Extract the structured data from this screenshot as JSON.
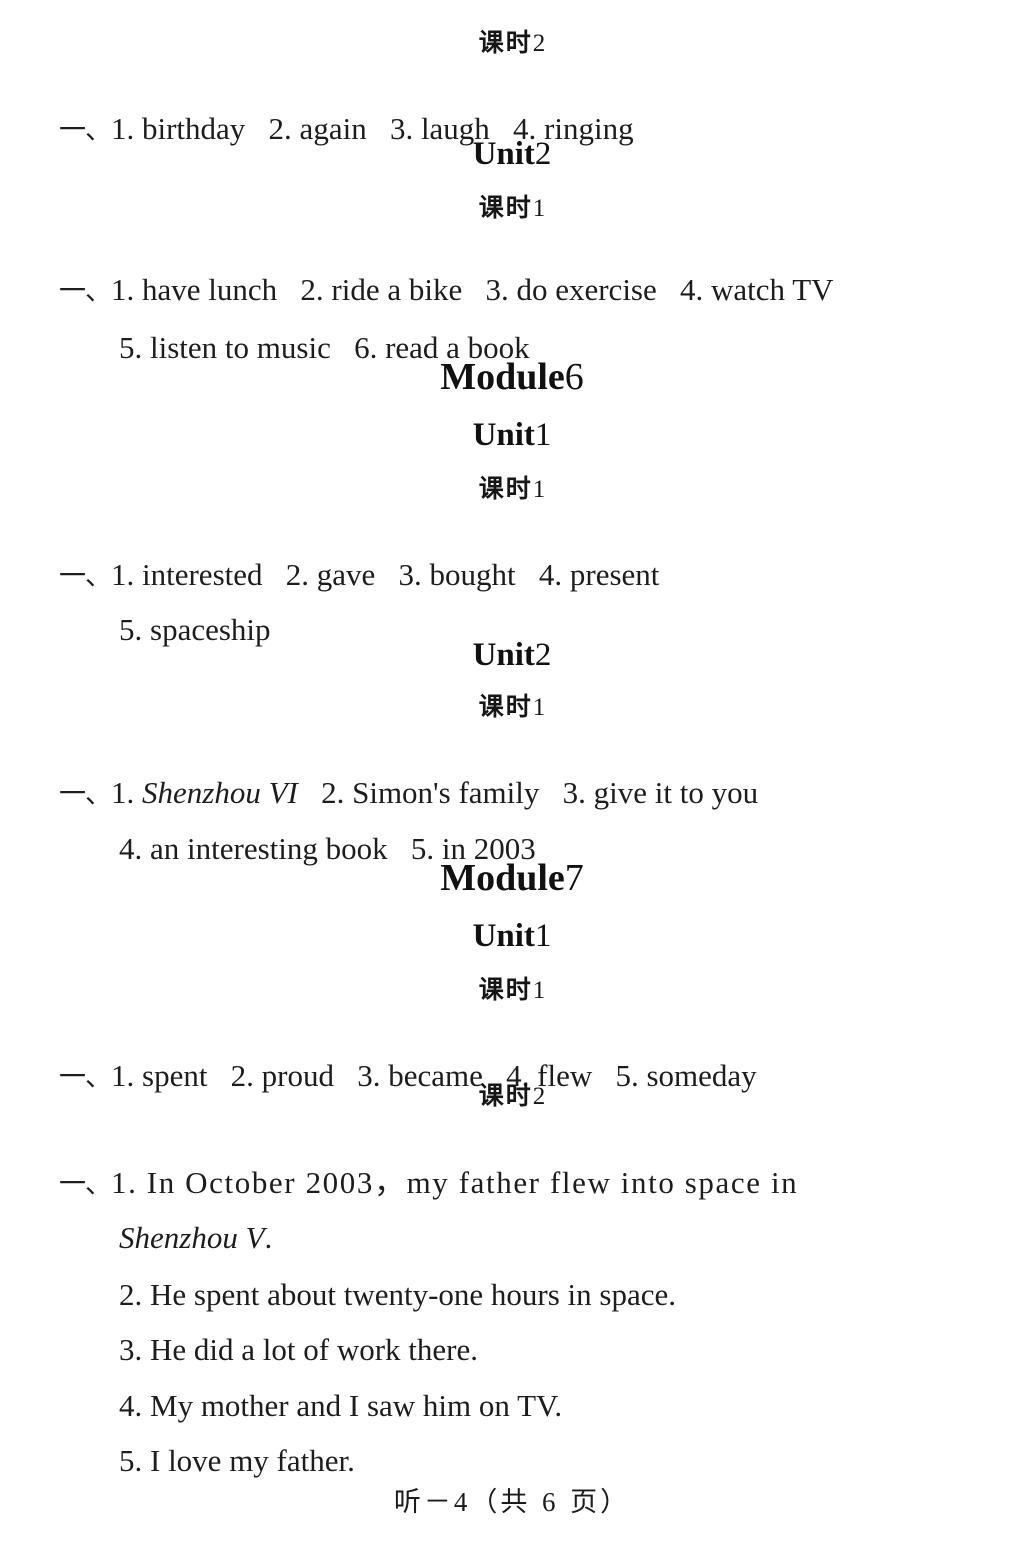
{
  "document": {
    "background_color": "#ffffff",
    "text_color": "#1b1b1b"
  },
  "labels": {
    "keshi": "课时",
    "unit": "Unit",
    "module": "Module",
    "section_marker": "一、"
  },
  "blocks": {
    "m5u1_keshi2": {
      "label": "课时",
      "num": "2"
    },
    "m5u1_keshi2_answers": "1. birthday   2. again   3. laugh   4. ringing",
    "m5u2_heading": {
      "label": "Unit",
      "num": "2"
    },
    "m5u2_keshi1": {
      "label": "课时",
      "num": "1"
    },
    "m5u2_line1": "1. have lunch   2. ride a bike   3. do exercise   4. watch TV",
    "m5u2_line2": "5. listen to music   6. read a book",
    "module6_heading": {
      "label": "Module",
      "num": "6"
    },
    "m6u1_heading": {
      "label": "Unit",
      "num": "1"
    },
    "m6u1_keshi1": {
      "label": "课时",
      "num": "1"
    },
    "m6u1_line1": "1. interested   2. gave   3. bought   4. present",
    "m6u1_line2": "5. spaceship",
    "m6u2_heading": {
      "label": "Unit",
      "num": "2"
    },
    "m6u2_keshi1": {
      "label": "课时",
      "num": "1"
    },
    "m6u2_line1_prefix": "1. ",
    "m6u2_line1_italic": "Shenzhou VI",
    "m6u2_line1_rest": "   2. Simon's family   3. give it to you",
    "m6u2_line2": "4. an interesting book   5. in 2003",
    "module7_heading": {
      "label": "Module",
      "num": "7"
    },
    "m7u1_heading": {
      "label": "Unit",
      "num": "1"
    },
    "m7u1_keshi1": {
      "label": "课时",
      "num": "1"
    },
    "m7u1_line1": "1. spent   2. proud   3. became   4. flew   5. someday",
    "m7u1_keshi2": {
      "label": "课时",
      "num": "2"
    },
    "m7u1_k2_s1_a": "1. In October 2003，my father flew into space in",
    "m7u1_k2_s1_b_italic": "Shenzhou V",
    "m7u1_k2_s1_b_rest": ".",
    "m7u1_k2_s2": "2. He spent about twenty-one hours in space.",
    "m7u1_k2_s3": "3. He did a lot of work there.",
    "m7u1_k2_s4": "4. My mother and I saw him on TV.",
    "m7u1_k2_s5": "5. I love my father."
  },
  "footer": {
    "prefix": "听－",
    "page_number": "4",
    "open_paren": "（共 ",
    "total_pages": "6",
    "close_paren": " 页）",
    "full_text": "听－4（共 6 页）"
  }
}
